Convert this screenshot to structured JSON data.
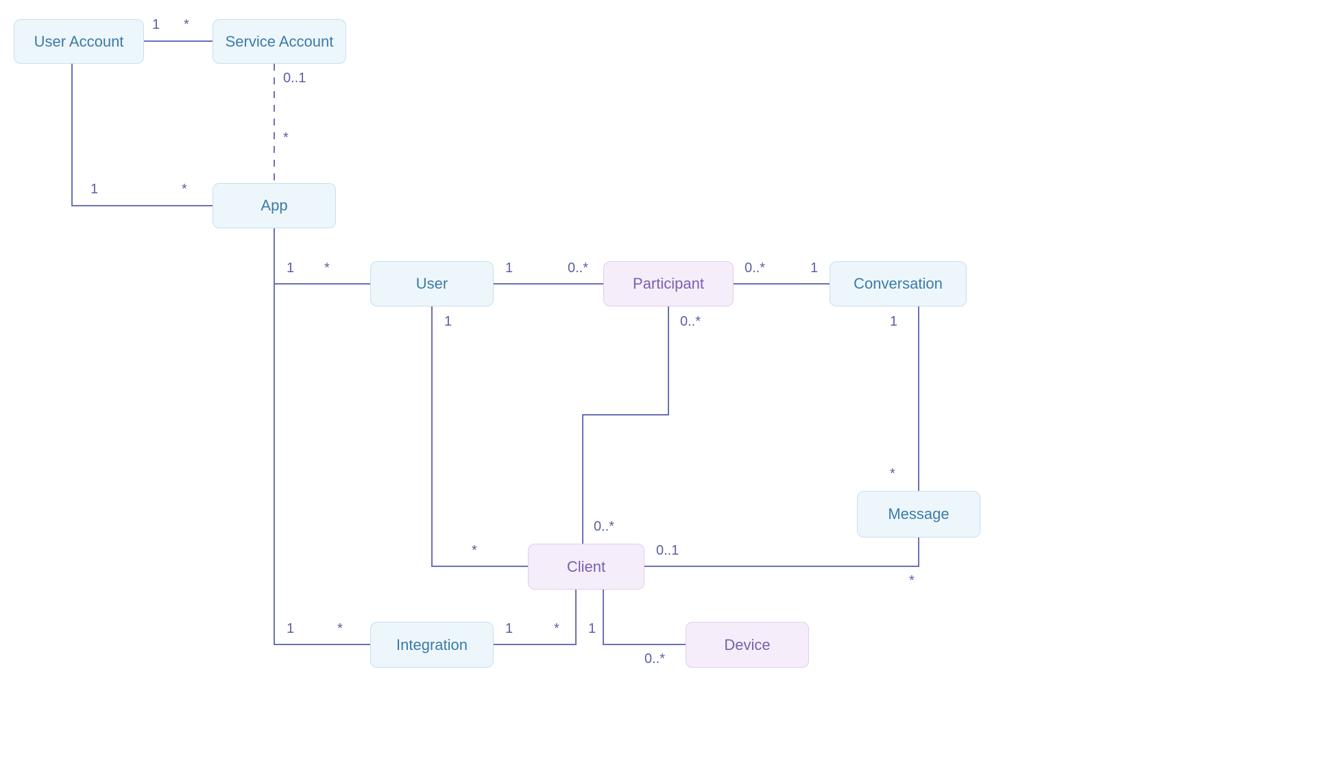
{
  "nodes": {
    "userAccount": {
      "label": "User Account",
      "style": "blue"
    },
    "serviceAccount": {
      "label": "Service Account",
      "style": "blue"
    },
    "app": {
      "label": "App",
      "style": "blue"
    },
    "user": {
      "label": "User",
      "style": "blue"
    },
    "participant": {
      "label": "Participant",
      "style": "purple"
    },
    "conversation": {
      "label": "Conversation",
      "style": "blue"
    },
    "client": {
      "label": "Client",
      "style": "purple"
    },
    "message": {
      "label": "Message",
      "style": "blue"
    },
    "integration": {
      "label": "Integration",
      "style": "blue"
    },
    "device": {
      "label": "Device",
      "style": "purple"
    }
  },
  "cardinalities": {
    "ua_sa_left": "1",
    "ua_sa_right": "*",
    "sa_app_top": "0..1",
    "sa_app_bottom": "*",
    "ua_app_left": "1",
    "ua_app_right": "*",
    "app_user_left": "1",
    "app_user_right": "*",
    "user_part_left": "1",
    "user_part_right": "0..*",
    "part_conv_left": "0..*",
    "part_conv_right": "1",
    "conv_msg_top": "1",
    "conv_msg_bottom": "*",
    "user_client_top": "1",
    "user_client_bottom": "*",
    "part_client_top": "0..*",
    "part_client_bottom": "0..*",
    "client_msg_left": "0..1",
    "client_msg_right": "*",
    "app_int_left": "1",
    "app_int_right": "*",
    "int_client_left": "1",
    "int_client_right": "*",
    "client_dev_left": "1",
    "client_dev_right": "0..*"
  }
}
